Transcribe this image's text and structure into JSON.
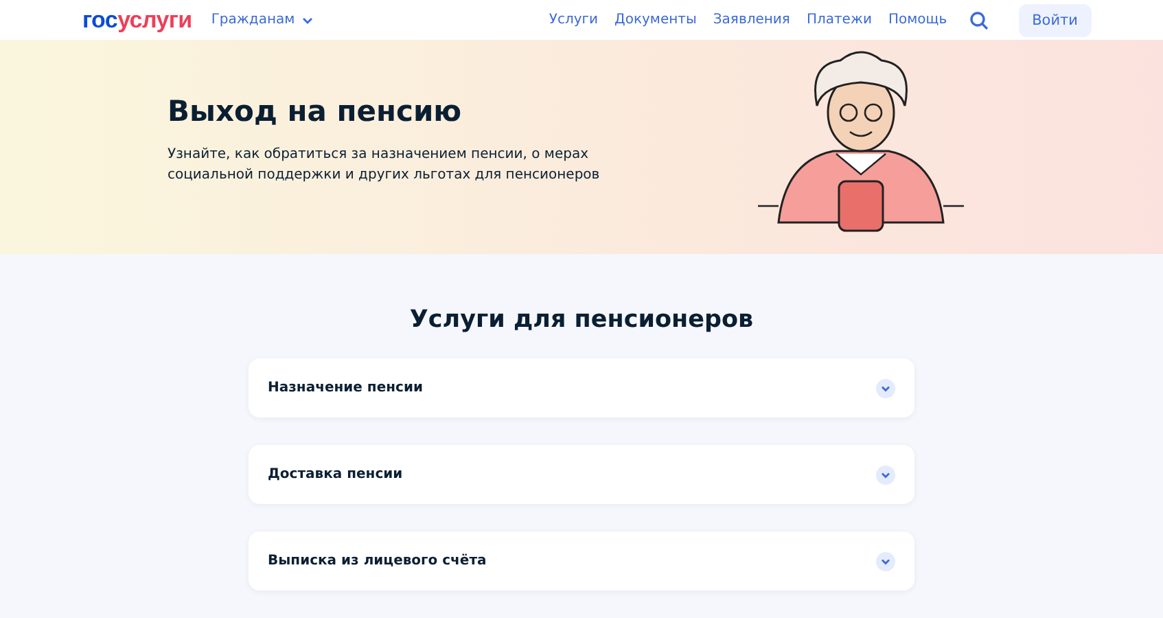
{
  "header": {
    "logo": {
      "part_1": "гос",
      "part_2": "услуги"
    },
    "audience": "Гражданам",
    "nav": [
      "Услуги",
      "Документы",
      "Заявления",
      "Платежи",
      "Помощь"
    ],
    "login": "Войти"
  },
  "hero": {
    "title": "Выход на пенсию",
    "text": "Узнайте, как обратиться за назначением пенсии, о мерах социальной поддержки и других льготах для пенсионеров"
  },
  "services": {
    "title": "Услуги для пенсионеров",
    "items": [
      {
        "label": "Назначение пенсии",
        "expanded": false
      },
      {
        "label": "Доставка пенсии",
        "expanded": false
      },
      {
        "label": "Выписка из лицевого счёта",
        "expanded": false
      }
    ]
  }
}
